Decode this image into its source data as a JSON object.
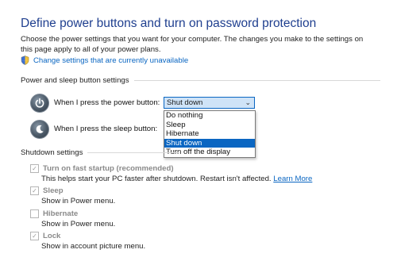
{
  "header": {
    "title": "Define power buttons and turn on password protection",
    "description": "Choose the power settings that you want for your computer. The changes you make to the settings on this page apply to all of your power plans.",
    "change_link": "Change settings that are currently unavailable"
  },
  "power_sleep": {
    "section_title": "Power and sleep button settings",
    "power_label": "When I press the power button:",
    "power_value": "Shut down",
    "sleep_label": "When I press the sleep button:",
    "options": [
      "Do nothing",
      "Sleep",
      "Hibernate",
      "Shut down",
      "Turn off the display"
    ],
    "selected_index": 3
  },
  "shutdown": {
    "section_title": "Shutdown settings",
    "fast_startup_label": "Turn on fast startup (recommended)",
    "fast_startup_checked": true,
    "fast_startup_desc": "This helps start your PC faster after shutdown. Restart isn't affected.",
    "learn_more": "Learn More",
    "sleep_label": "Sleep",
    "sleep_checked": true,
    "sleep_desc": "Show in Power menu.",
    "hibernate_label": "Hibernate",
    "hibernate_checked": false,
    "hibernate_desc": "Show in Power menu.",
    "lock_label": "Lock",
    "lock_checked": true,
    "lock_desc": "Show in account picture menu."
  },
  "colors": {
    "title": "#1f3f8f",
    "link": "#0a66c2",
    "selection": "#0a66c2",
    "disabled_text": "#8a8a8a"
  },
  "icons": [
    "shield-icon",
    "power-icon",
    "sleep-icon",
    "chevron-down-icon",
    "checkbox-check-icon"
  ]
}
